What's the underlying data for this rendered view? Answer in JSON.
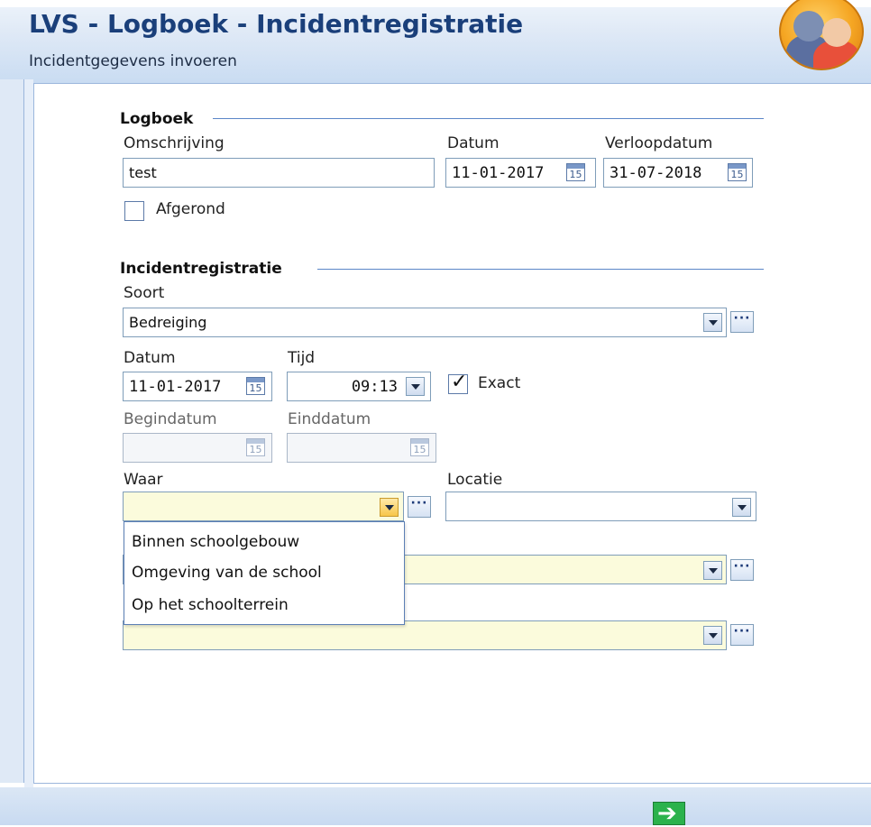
{
  "header": {
    "title": "LVS - Logboek - Incidentregistratie",
    "subtitle": "Incidentgegevens invoeren",
    "avatar_icon": "people-icon"
  },
  "logboek": {
    "legend": "Logboek",
    "omschrijving_label": "Omschrijving",
    "omschrijving_value": "test",
    "datum_label": "Datum",
    "datum_value": "11-01-2017",
    "verloopdatum_label": "Verloopdatum",
    "verloopdatum_value": "31-07-2018",
    "afgerond_label": "Afgerond",
    "afgerond_checked": false
  },
  "incident": {
    "legend": "Incidentregistratie",
    "soort_label": "Soort",
    "soort_value": "Bedreiging",
    "datum_label": "Datum",
    "datum_value": "11-01-2017",
    "tijd_label": "Tijd",
    "tijd_value": "09:13",
    "exact_label": "Exact",
    "exact_checked": true,
    "begindatum_label": "Begindatum",
    "begindatum_value": "",
    "einddatum_label": "Einddatum",
    "einddatum_value": "",
    "waar_label": "Waar",
    "waar_value": "",
    "locatie_label": "Locatie",
    "locatie_value": ""
  },
  "waar_dropdown": {
    "options": [
      "Binnen schoolgebouw",
      "Omgeving van de school",
      "Op het schoolterrein"
    ]
  },
  "calendar_icon_text": "15",
  "more_button_text": "···",
  "footer": {
    "next_icon": "arrow-right-icon",
    "next_glyph": "➔"
  }
}
